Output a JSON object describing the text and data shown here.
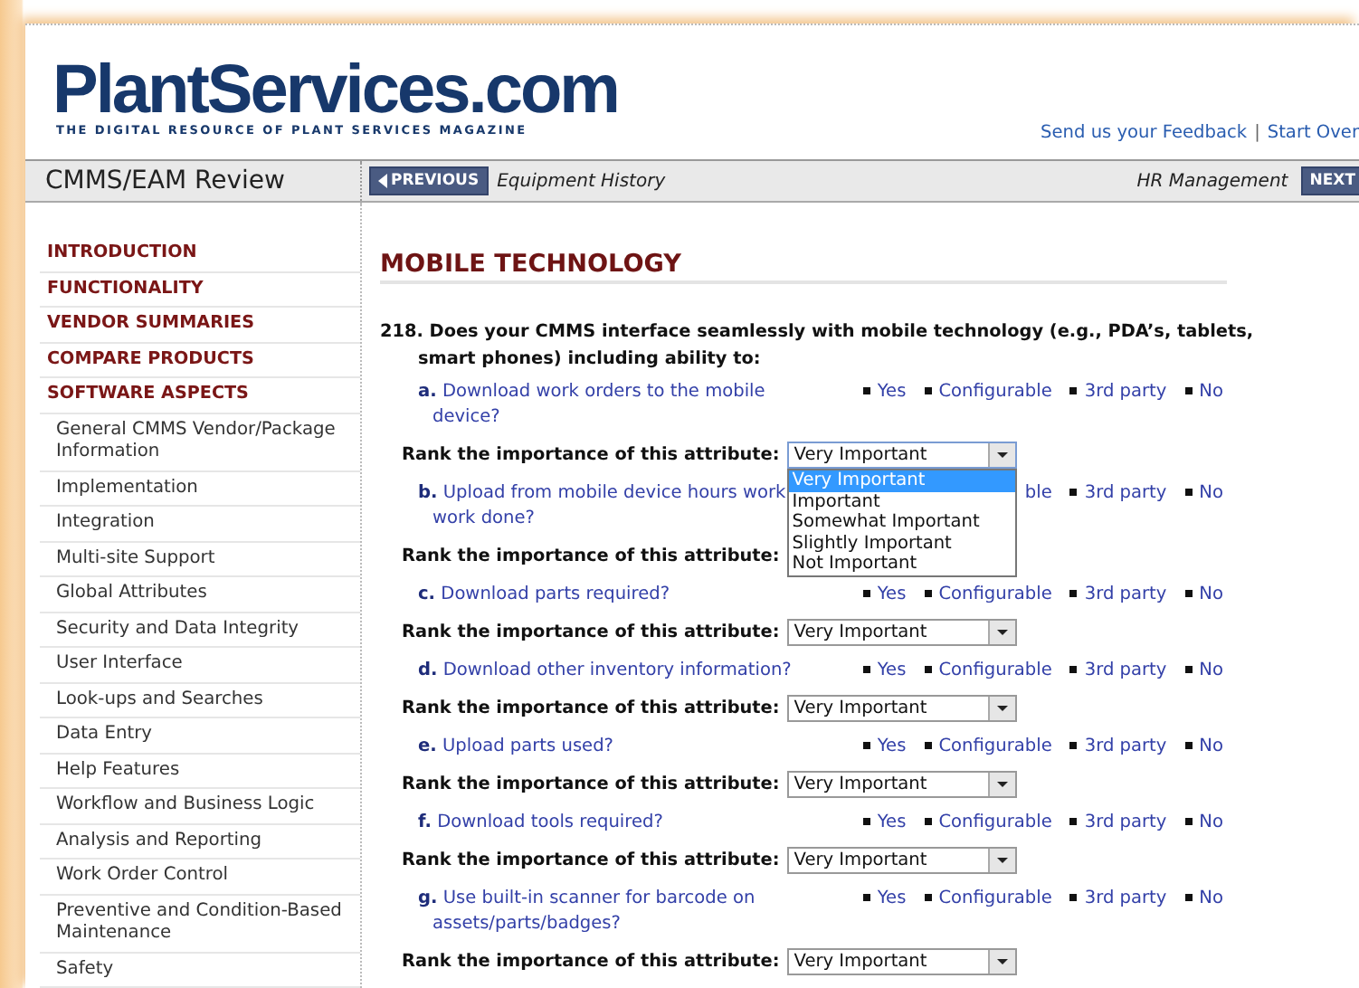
{
  "header": {
    "logo": "PlantServices.com",
    "tagline": "THE DIGITAL RESOURCE OF PLANT SERVICES MAGAZINE",
    "links": [
      "Send us your Feedback",
      "Start Over"
    ],
    "separator": "|"
  },
  "nav": {
    "title": "CMMS/EAM Review",
    "previous": {
      "button": "PREVIOUS",
      "label": "Equipment History"
    },
    "next": {
      "label": "HR Management",
      "button": "NEXT"
    }
  },
  "sidebar": [
    {
      "label": "INTRODUCTION",
      "kind": "section"
    },
    {
      "label": "FUNCTIONALITY",
      "kind": "section"
    },
    {
      "label": "VENDOR SUMMARIES",
      "kind": "section"
    },
    {
      "label": "COMPARE PRODUCTS",
      "kind": "section"
    },
    {
      "label": "SOFTWARE ASPECTS",
      "kind": "section"
    },
    {
      "label": "General CMMS Vendor/Package Information",
      "kind": "page"
    },
    {
      "label": "Implementation",
      "kind": "page"
    },
    {
      "label": "Integration",
      "kind": "page"
    },
    {
      "label": "Multi-site Support",
      "kind": "page"
    },
    {
      "label": "Global Attributes",
      "kind": "page"
    },
    {
      "label": "Security and Data Integrity",
      "kind": "page"
    },
    {
      "label": "User Interface",
      "kind": "page"
    },
    {
      "label": "Look-ups and Searches",
      "kind": "page"
    },
    {
      "label": "Data Entry",
      "kind": "page"
    },
    {
      "label": "Help Features",
      "kind": "page"
    },
    {
      "label": "Workflow and Business Logic",
      "kind": "page"
    },
    {
      "label": "Analysis and Reporting",
      "kind": "page"
    },
    {
      "label": "Work Order Control",
      "kind": "page"
    },
    {
      "label": "Preventive and Condition-Based Maintenance",
      "kind": "page"
    },
    {
      "label": "Safety",
      "kind": "page"
    }
  ],
  "section_title": "MOBILE TECHNOLOGY",
  "question": {
    "number": "218.",
    "text": "Does your CMMS interface seamlessly with mobile technology (e.g., PDA’s, tablets, smart phones) including ability to:"
  },
  "items": [
    {
      "text": "**a.** Download work orders to the mobile device?",
      "options": [
        {
          "label": "Yes",
          "bullet": true
        },
        {
          "label": "Configurable",
          "bullet": true
        },
        {
          "label": "3rd party",
          "bullet": true
        },
        {
          "label": "No",
          "bullet": true
        }
      ],
      "rank_label": "Rank the importance of this attribute:",
      "rank_value": "Very Important",
      "expanded": true,
      "menu": [
        {
          "label": "Very Important",
          "selected": true
        },
        {
          "label": "Important",
          "selected": false
        },
        {
          "label": "Somewhat Important",
          "selected": false
        },
        {
          "label": "Slightly Important",
          "selected": false
        },
        {
          "label": "Not Important",
          "selected": false
        }
      ]
    },
    {
      "text": "**b.** Upload from mobile device hours work",
      "continuation": "work done?",
      "options": [
        {
          "label": "ble",
          "bullet": false
        },
        {
          "label": "3rd party",
          "bullet": true
        },
        {
          "label": "No",
          "bullet": true
        }
      ],
      "rank_label": "Rank the importance of this attribute:"
    },
    {
      "text": "**c.** Download parts required?",
      "options": [
        {
          "label": "Yes",
          "bullet": true
        },
        {
          "label": "Configurable",
          "bullet": true
        },
        {
          "label": "3rd party",
          "bullet": true
        },
        {
          "label": "No",
          "bullet": true
        }
      ],
      "rank_label": "Rank the importance of this attribute:",
      "rank_value": "Very Important"
    },
    {
      "text": "**d.** Download other inventory information?",
      "options": [
        {
          "label": "Yes",
          "bullet": true
        },
        {
          "label": "Configurable",
          "bullet": true
        },
        {
          "label": "3rd party",
          "bullet": true
        },
        {
          "label": "No",
          "bullet": true
        }
      ],
      "rank_label": "Rank the importance of this attribute:",
      "rank_value": "Very Important"
    },
    {
      "text": "**e.** Upload parts used?",
      "options": [
        {
          "label": "Yes",
          "bullet": true
        },
        {
          "label": "Configurable",
          "bullet": true
        },
        {
          "label": "3rd party",
          "bullet": true
        },
        {
          "label": "No",
          "bullet": true
        }
      ],
      "rank_label": "Rank the importance of this attribute:",
      "rank_value": "Very Important"
    },
    {
      "text": "**f.** Download tools required?",
      "options": [
        {
          "label": "Yes",
          "bullet": true
        },
        {
          "label": "Configurable",
          "bullet": true
        },
        {
          "label": "3rd party",
          "bullet": true
        },
        {
          "label": "No",
          "bullet": true
        }
      ],
      "rank_label": "Rank the importance of this attribute:",
      "rank_value": "Very Important"
    },
    {
      "text": "**g.** Use built-in scanner for barcode on assets/parts/badges?",
      "options": [
        {
          "label": "Yes",
          "bullet": true
        },
        {
          "label": "Configurable",
          "bullet": true
        },
        {
          "label": "3rd party",
          "bullet": true
        },
        {
          "label": "No",
          "bullet": true
        }
      ],
      "rank_label": "Rank the importance of this attribute:",
      "rank_value": "Very Important"
    }
  ]
}
